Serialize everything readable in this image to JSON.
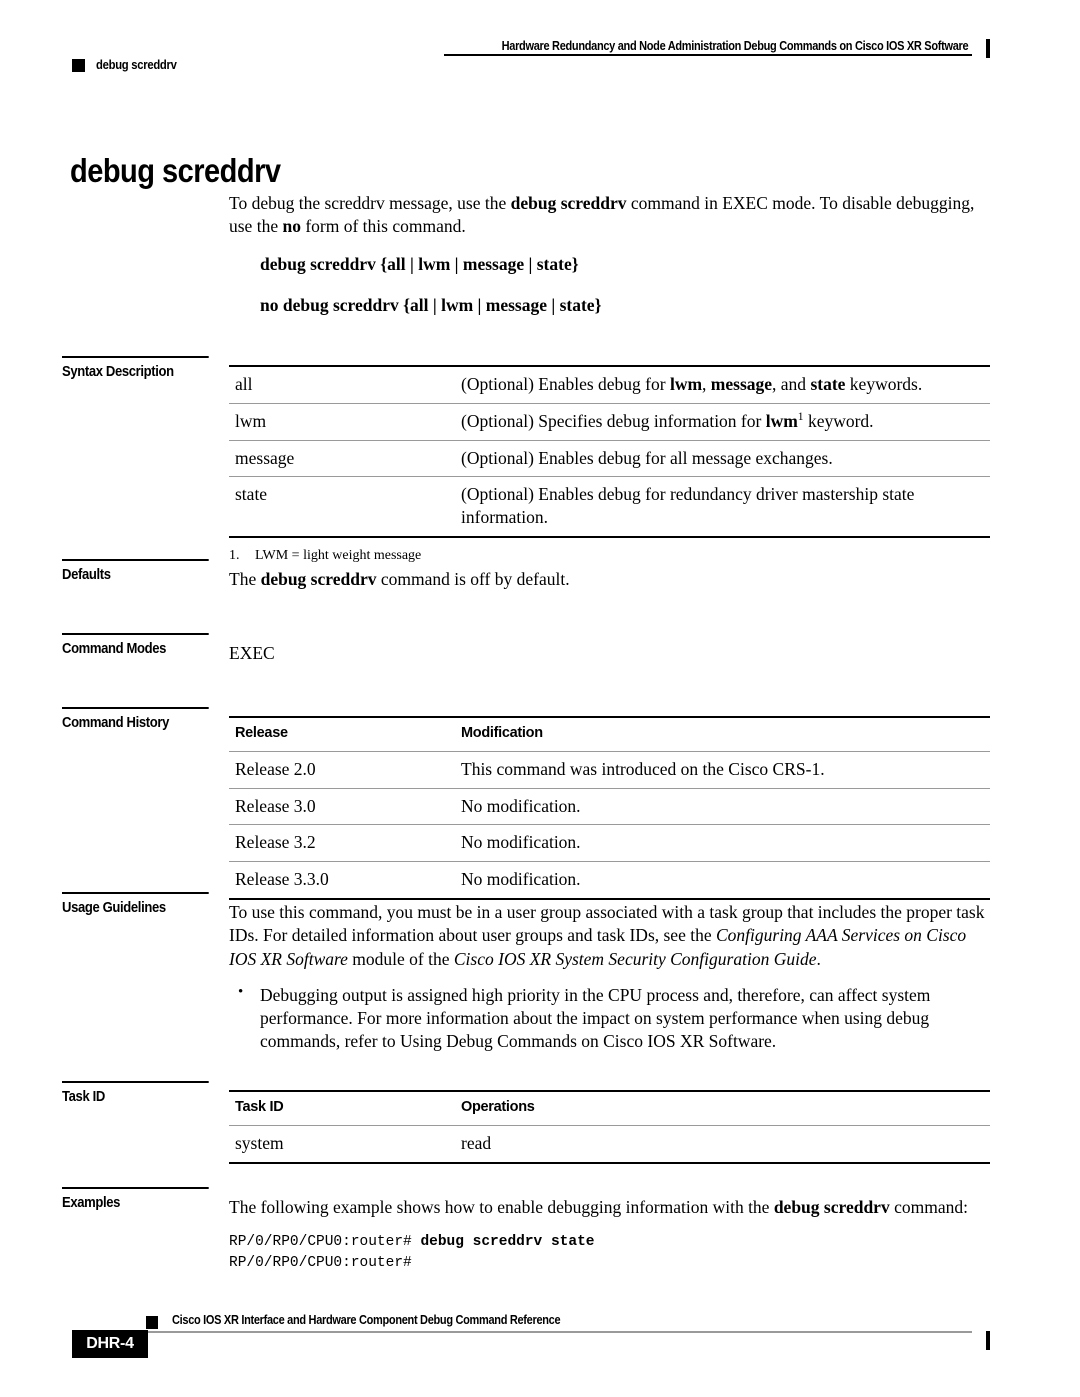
{
  "header": {
    "title": "Hardware Redundancy and Node Administration Debug Commands on Cisco IOS XR Software",
    "subtitle": "debug screddrv"
  },
  "command": {
    "title": "debug screddrv",
    "description_html": "To debug the screddrv message, use the <b>debug screddrv</b> command in EXEC mode. To disable debugging, use the <b>no</b> form of this command.",
    "syntax": "debug screddrv {all | lwm | message | state}",
    "syntax_no": "no debug screddrv {all | lwm | message | state}"
  },
  "sections": {
    "syntax_description": {
      "label": "Syntax Description",
      "rows": [
        {
          "keyword": "all",
          "description_html": "(Optional) Enables debug for <b>lwm</b>, <b>message</b>, and <b>state</b> keywords."
        },
        {
          "keyword": "lwm",
          "description_html": "(Optional) Specifies debug information for <b>lwm</b><sup>1</sup> keyword."
        },
        {
          "keyword": "message",
          "description_html": "(Optional) Enables debug for all message exchanges."
        },
        {
          "keyword": "state",
          "description_html": "(Optional) Enables debug for redundancy driver mastership state information."
        }
      ],
      "footnote_number": "1.",
      "footnote_text": "LWM = light weight message"
    },
    "defaults": {
      "label": "Defaults",
      "text_html": "The <b>debug screddrv</b> command is off by default."
    },
    "command_modes": {
      "label": "Command Modes",
      "text": "EXEC"
    },
    "command_history": {
      "label": "Command History",
      "columns": [
        "Release",
        "Modification"
      ],
      "rows": [
        [
          "Release 2.0",
          "This command was introduced on the Cisco CRS-1."
        ],
        [
          "Release 3.0",
          "No modification."
        ],
        [
          "Release 3.2",
          "No modification."
        ],
        [
          "Release 3.3.0",
          "No modification."
        ]
      ]
    },
    "usage_guidelines": {
      "label": "Usage Guidelines",
      "paragraph_html": "To use this command, you must be in a user group associated with a task group that includes the proper task IDs. For detailed information about user groups and task IDs, see the <i>Configuring AAA Services on Cisco IOS XR Software</i> module of the <i>Cisco IOS XR System Security Configuration Guide</i>.",
      "bullets": [
        "Debugging output is assigned high priority in the CPU process and, therefore, can affect system performance. For more information about the impact on system performance when using debug commands, refer to Using Debug Commands on Cisco IOS XR Software."
      ]
    },
    "task_id": {
      "label": "Task ID",
      "columns": [
        "Task ID",
        "Operations"
      ],
      "rows": [
        [
          "system",
          "read"
        ]
      ]
    },
    "examples": {
      "label": "Examples",
      "intro_html": "The following example shows how to enable debugging information with the <b>debug screddrv</b> command:",
      "code_html": "RP/0/RP0/CPU0:router# <b>debug screddrv state</b>\nRP/0/RP0/CPU0:router#"
    }
  },
  "footer": {
    "title": "Cisco IOS XR Interface and Hardware Component Debug Command Reference",
    "page_number": "DHR-4"
  }
}
